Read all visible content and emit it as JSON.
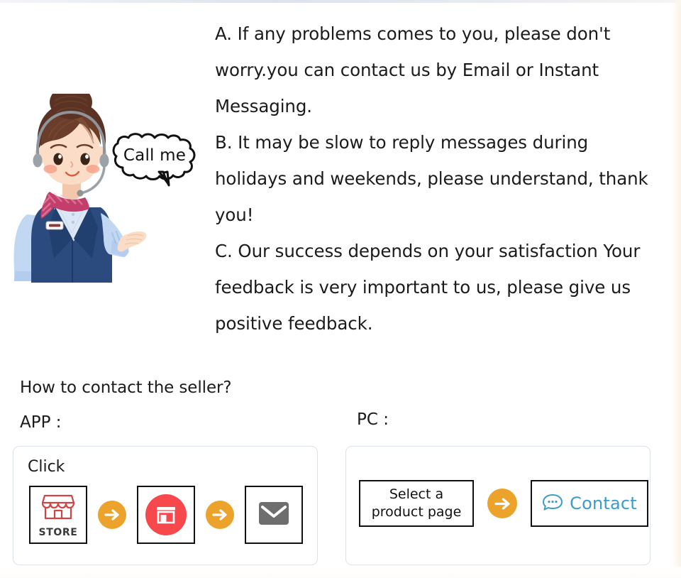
{
  "page": {
    "background": "#ffffff",
    "accent_orange": "#eca32c",
    "accent_red": "#f7484e",
    "accent_blue": "#3c9cc8",
    "card_border": "#dbe2ec",
    "text_color": "#1b1b1b"
  },
  "illustration": {
    "name": "customer-service-agent",
    "speech_bubble_text": "Call me",
    "hair_color": "#5b3325",
    "vest_color": "#2b4a7e",
    "shirt_color": "#bad2f0",
    "scarf_color": "#c43e6b",
    "skin_color": "#fbdcc6"
  },
  "notes": {
    "items": [
      "A. If any problems comes to you, please don't worry.you can contact us by Email or Instant Messaging.",
      "B. It may be slow to reply messages during holidays and weekends, please understand, thank you!",
      "C. Our success depends on your satisfaction Your feedback is very important to us, please give us positive feedback."
    ]
  },
  "howto": {
    "heading": "How to contact the seller?",
    "app_label": "APP :",
    "pc_label": "PC :"
  },
  "app_card": {
    "click_label": "Click",
    "steps": [
      {
        "icon": "storefront-outline-icon",
        "caption": "STORE"
      },
      {
        "icon": "arrow-right-icon"
      },
      {
        "icon": "storefront-filled-icon"
      },
      {
        "icon": "arrow-right-icon"
      },
      {
        "icon": "envelope-icon"
      }
    ]
  },
  "pc_card": {
    "steps": [
      {
        "icon": "",
        "line1": "Select a",
        "line2": "product page"
      },
      {
        "icon": "arrow-right-icon"
      },
      {
        "icon": "chat-bubble-icon",
        "label": "Contact"
      }
    ]
  }
}
